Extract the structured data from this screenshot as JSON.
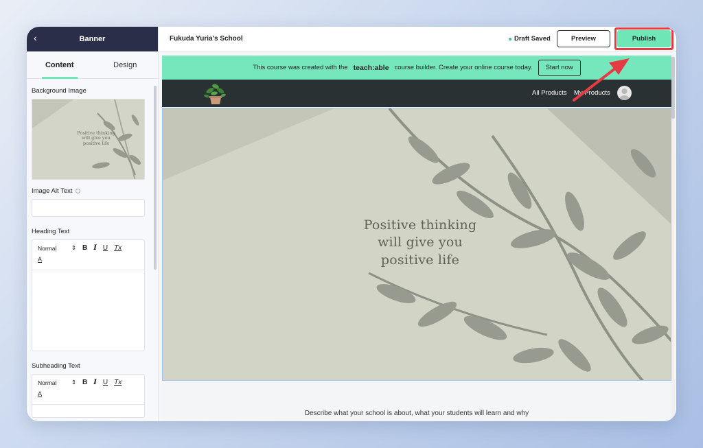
{
  "sidebar": {
    "title": "Banner",
    "back_icon": "chevron-left-icon",
    "tabs": [
      {
        "label": "Content",
        "active": true
      },
      {
        "label": "Design",
        "active": false
      }
    ],
    "background_image_label": "Background Image",
    "thumbnail_text": [
      "Positive thinking",
      "will give you",
      "positive life"
    ],
    "image_alt_label": "Image Alt Text",
    "image_alt_value": "",
    "heading_label": "Heading Text",
    "subheading_label": "Subheading Text",
    "toolbar": {
      "format_value": "Normal",
      "bold": "B",
      "italic": "I",
      "underline": "U",
      "clear_format": "Tx",
      "text_color": "A"
    }
  },
  "topbar": {
    "school_name": "Fukuda Yuria's School",
    "status": "Draft Saved",
    "preview_label": "Preview",
    "publish_label": "Publish"
  },
  "promo": {
    "text_before": "This course was created with the",
    "brand": "teach:able",
    "text_after": "course builder. Create your online course today.",
    "button_label": "Start now"
  },
  "nav": {
    "links": [
      "All Products",
      "My Products"
    ]
  },
  "banner": {
    "heading_lines": [
      "Positive thinking",
      "will give you",
      "positive life"
    ]
  },
  "describe_text": "Describe what your school is about, what your students will learn and why",
  "colors": {
    "sidebar_header": "#2a2e48",
    "accent_green": "#6ee6b5",
    "promo_bar": "#76e7bd",
    "nav_dark": "#2a3132",
    "annotation_red": "#e53b45"
  }
}
